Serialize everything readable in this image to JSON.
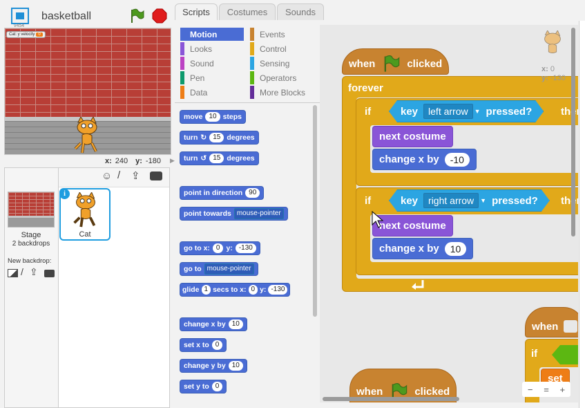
{
  "stage": {
    "project_title": "basketball",
    "version_label": "v454",
    "variable_monitor": {
      "label": "Cat: y velocity",
      "value": "0"
    },
    "coords": {
      "x_label": "x:",
      "x": "240",
      "y_label": "y:",
      "y": "-180"
    }
  },
  "sprites_panel": {
    "stage_label": "Stage",
    "stage_backdrops": "2 backdrops",
    "new_backdrop_label": "New backdrop:",
    "sprites": [
      {
        "name": "Cat",
        "selected": true
      }
    ]
  },
  "tabs": [
    {
      "label": "Scripts",
      "active": true
    },
    {
      "label": "Costumes",
      "active": false
    },
    {
      "label": "Sounds",
      "active": false
    }
  ],
  "categories": {
    "left": [
      {
        "label": "Motion",
        "color": "#4a6cd4",
        "selected": true
      },
      {
        "label": "Looks",
        "color": "#8a55d7",
        "selected": false
      },
      {
        "label": "Sound",
        "color": "#bb42c3",
        "selected": false
      },
      {
        "label": "Pen",
        "color": "#0e9a6c",
        "selected": false
      },
      {
        "label": "Data",
        "color": "#ee7d16",
        "selected": false
      }
    ],
    "right": [
      {
        "label": "Events",
        "color": "#c88330"
      },
      {
        "label": "Control",
        "color": "#e1a91a"
      },
      {
        "label": "Sensing",
        "color": "#2ca5e2"
      },
      {
        "label": "Operators",
        "color": "#5cb712"
      },
      {
        "label": "More Blocks",
        "color": "#632d99"
      }
    ]
  },
  "palette": {
    "move": {
      "a": "move",
      "n": "10",
      "b": "steps"
    },
    "turn_right": {
      "a": "turn",
      "n": "15",
      "b": "degrees"
    },
    "turn_left": {
      "a": "turn",
      "n": "15",
      "b": "degrees"
    },
    "point_direction": {
      "a": "point in direction",
      "n": "90"
    },
    "point_towards": {
      "a": "point towards",
      "d": "mouse-pointer"
    },
    "go_to_xy": {
      "a": "go to x:",
      "x": "0",
      "b": "y:",
      "y": "-130"
    },
    "go_to": {
      "a": "go to",
      "d": "mouse-pointer"
    },
    "glide": {
      "a": "glide",
      "n": "1",
      "b": "secs to x:",
      "x": "0",
      "c": "y:",
      "y": "-130"
    },
    "change_x": {
      "a": "change x by",
      "n": "10"
    },
    "set_x": {
      "a": "set x to",
      "n": "0"
    },
    "change_y": {
      "a": "change y by",
      "n": "10"
    },
    "set_y": {
      "a": "set y to",
      "n": "0"
    }
  },
  "script": {
    "hat": {
      "a": "when",
      "b": "clicked"
    },
    "forever": "forever",
    "if1": {
      "if": "if",
      "key": "key",
      "dd": "left arrow",
      "pressed": "pressed?",
      "then": "then"
    },
    "next_costume_1": "next costume",
    "change_x_1": {
      "a": "change x by",
      "n": "-10"
    },
    "if2": {
      "if": "if",
      "key": "key",
      "dd": "right arrow",
      "pressed": "pressed?",
      "then": "then"
    },
    "next_costume_2": "next costume",
    "change_x_2": {
      "a": "change x by",
      "n": "10"
    }
  },
  "script2": {
    "a": "when",
    "b": "clicked"
  },
  "script3": {
    "a": "when",
    "if": "if",
    "set": "set"
  },
  "sprite_info": {
    "x_label": "x:",
    "x": "0",
    "y_label": "y:",
    "y": "-130"
  },
  "zoom": {
    "out": "−",
    "reset": "=",
    "in": "+"
  },
  "icons": {
    "fullscreen": "fullscreen-icon",
    "green_flag": "green-flag-icon",
    "stop": "stop-sign-icon",
    "sprite_info": "info-icon",
    "paint": "paintbrush-icon",
    "upload": "upload-icon",
    "camera": "camera-icon"
  },
  "colors": {
    "motion": "#4a6cd4",
    "events": "#c88330",
    "control": "#e1a91a",
    "looks": "#8a55d7",
    "sensing": "#2ca5e2"
  }
}
